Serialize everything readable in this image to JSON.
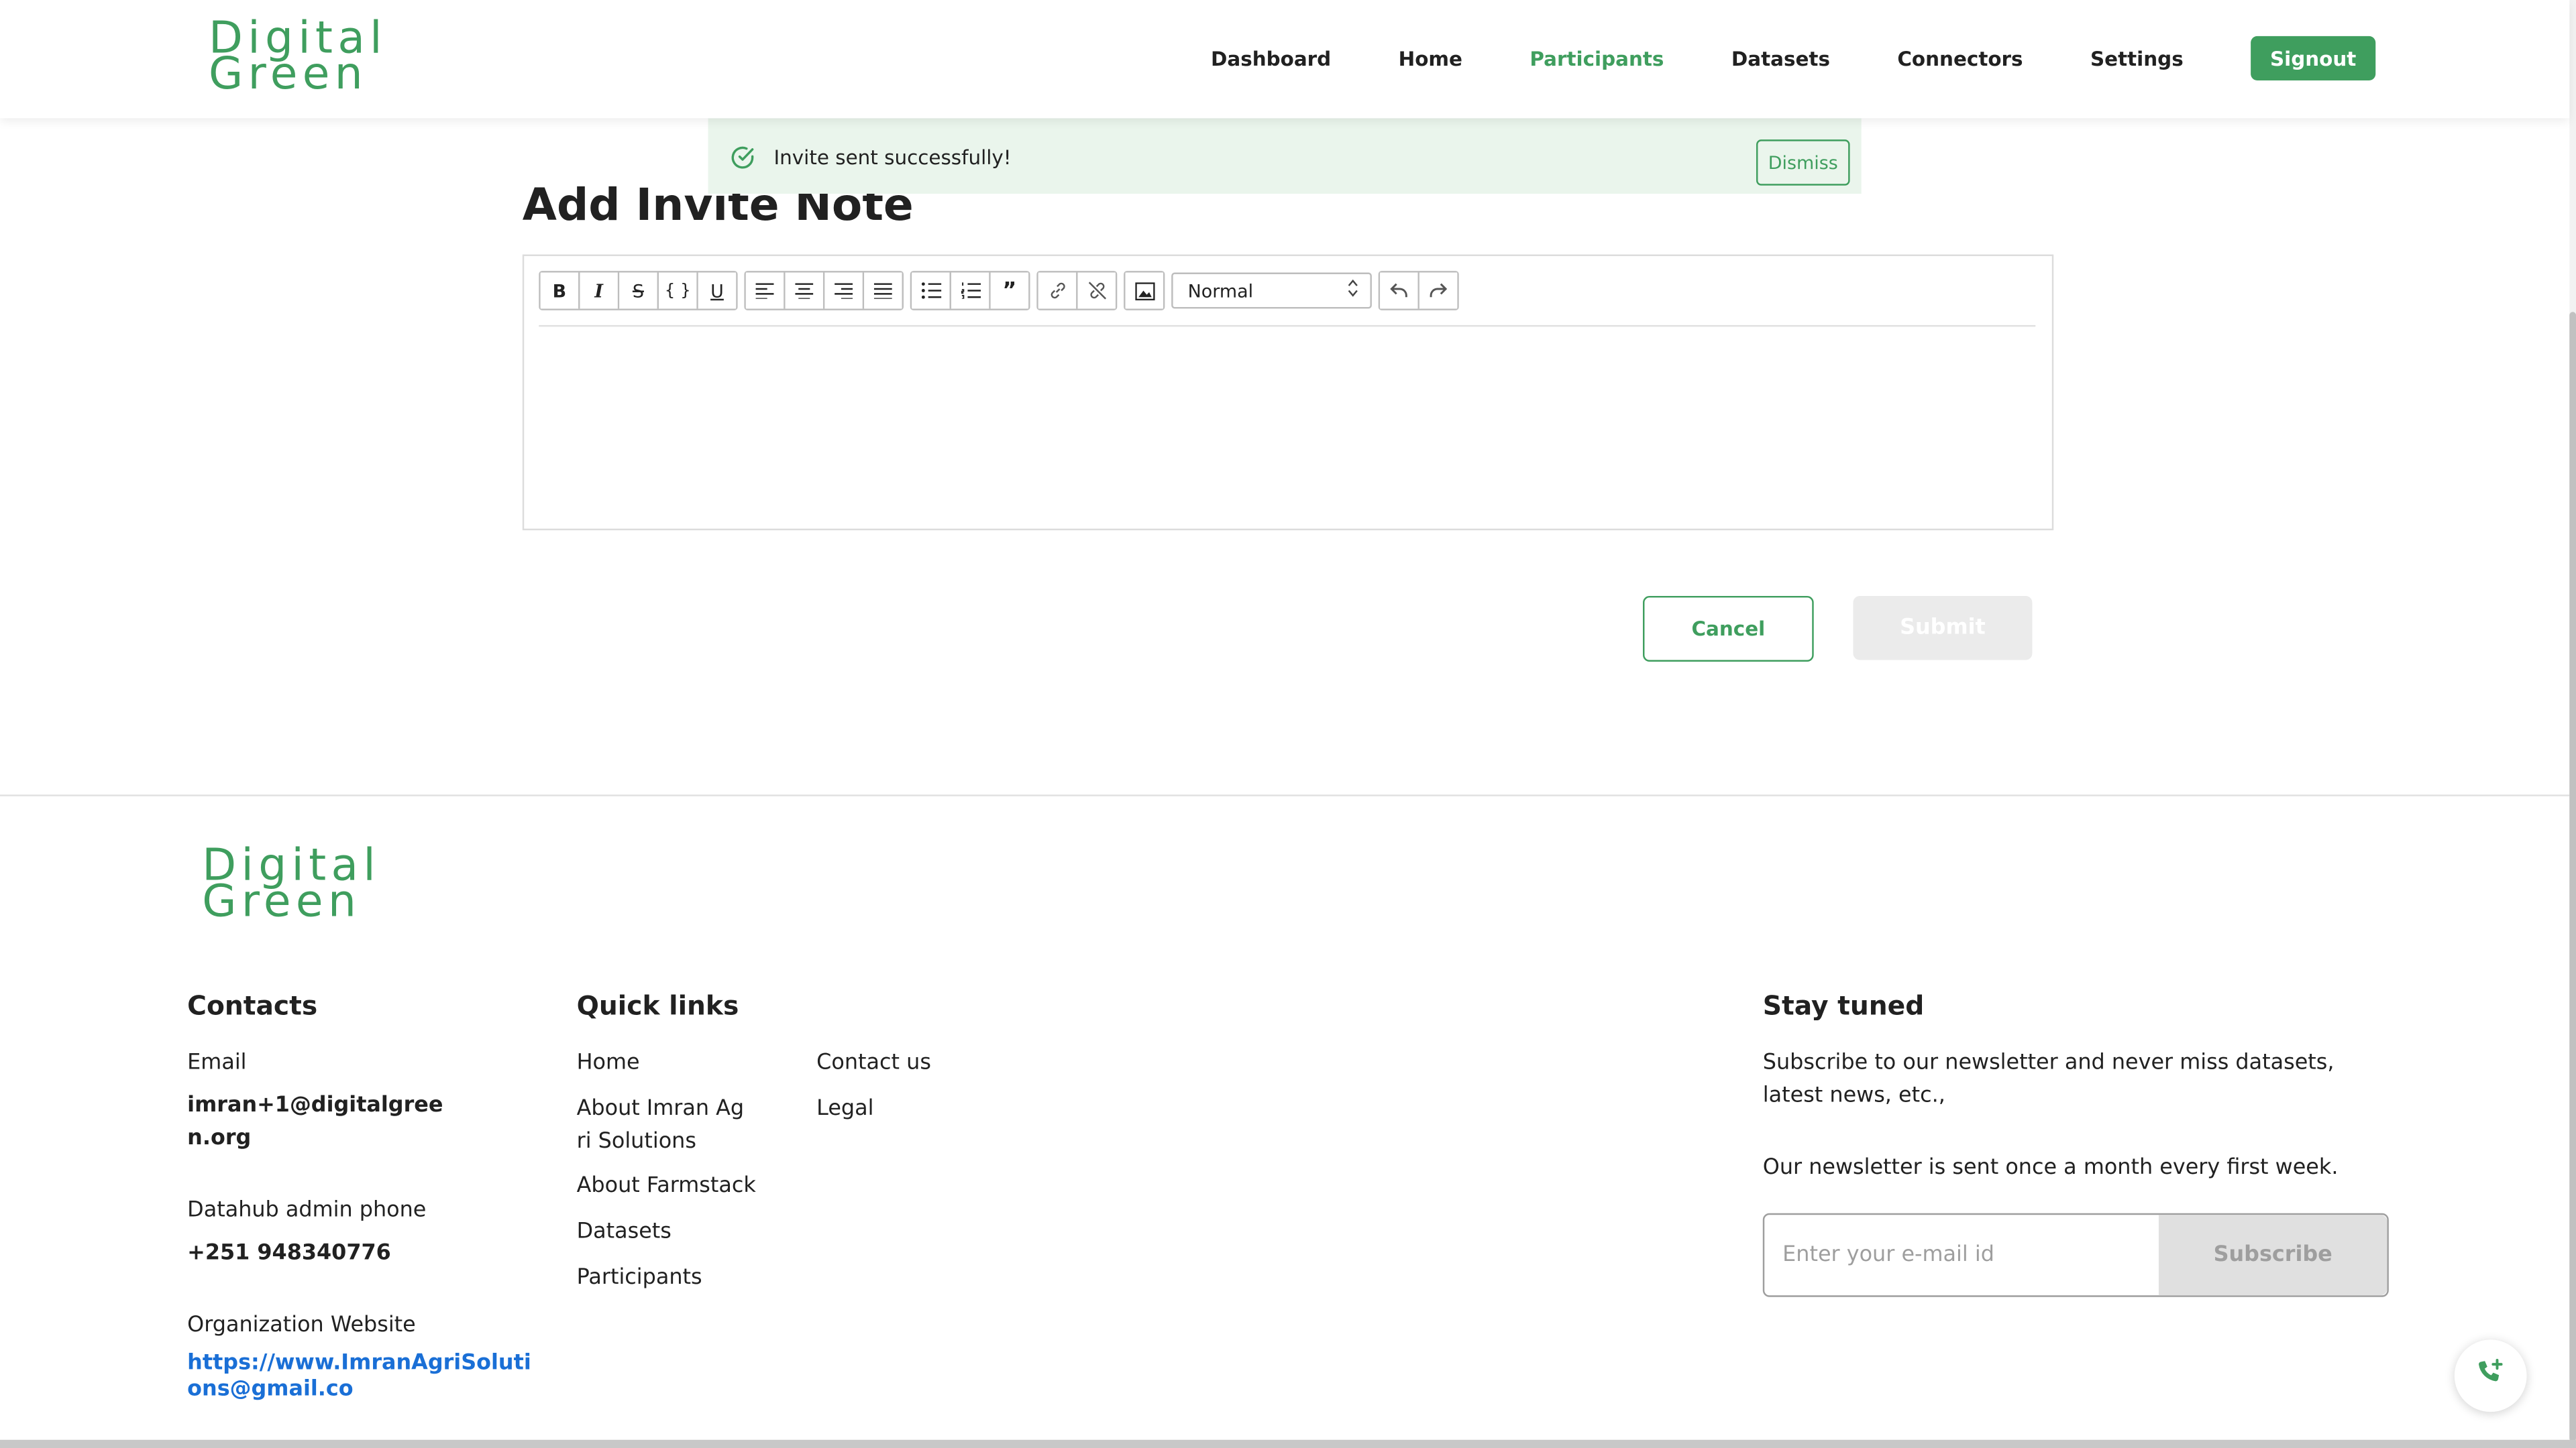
{
  "header": {
    "logo_line1": "Digital",
    "logo_line2": "Green",
    "nav": [
      "Dashboard",
      "Home",
      "Participants",
      "Datasets",
      "Connectors",
      "Settings"
    ],
    "active_nav": "Participants",
    "signout_label": "Signout"
  },
  "toast": {
    "message": "Invite sent successfully!",
    "dismiss_label": "Dismiss",
    "icon": "check-circle-icon"
  },
  "page": {
    "title": "Add Invite Note"
  },
  "editor": {
    "format_select_value": "Normal",
    "toolbar_icons": [
      "bold-icon",
      "italic-icon",
      "strikethrough-icon",
      "code-icon",
      "underline-icon",
      "align-left-icon",
      "align-center-icon",
      "align-right-icon",
      "align-justify-icon",
      "bullet-list-icon",
      "numbered-list-icon",
      "blockquote-icon",
      "link-icon",
      "unlink-icon",
      "image-icon",
      "undo-icon",
      "redo-icon"
    ],
    "content": ""
  },
  "actions": {
    "cancel_label": "Cancel",
    "submit_label": "Submit"
  },
  "footer": {
    "logo_line1": "Digital",
    "logo_line2": "Green",
    "contacts": {
      "heading": "Contacts",
      "email_label": "Email",
      "email_line1": "imran+1@digitalgree",
      "email_line2": "n.org",
      "phone_label": "Datahub admin phone",
      "phone_value": "+251 948340776",
      "website_label": "Organization Website",
      "website_line1": "https://www.ImranAgriSoluti",
      "website_line2": "ons@gmail.co"
    },
    "quick_links": {
      "heading": "Quick links",
      "col1": [
        "Home",
        "About Imran Ag",
        "ri Solutions",
        "About Farmstack",
        "Datasets",
        "Participants"
      ],
      "col2": [
        "Contact us",
        "Legal"
      ]
    },
    "stay_tuned": {
      "heading": "Stay tuned",
      "line1": "Subscribe to our newsletter and never miss datasets,",
      "line2": "latest news, etc.,",
      "line3": "Our newsletter is sent once a month every first week.",
      "email_placeholder": "Enter your e-mail id",
      "subscribe_label": "Subscribe"
    }
  },
  "colors": {
    "brand_green": "#3f9e5e",
    "link_blue": "#1a6fd6",
    "toast_bg": "#eaf5ec"
  }
}
